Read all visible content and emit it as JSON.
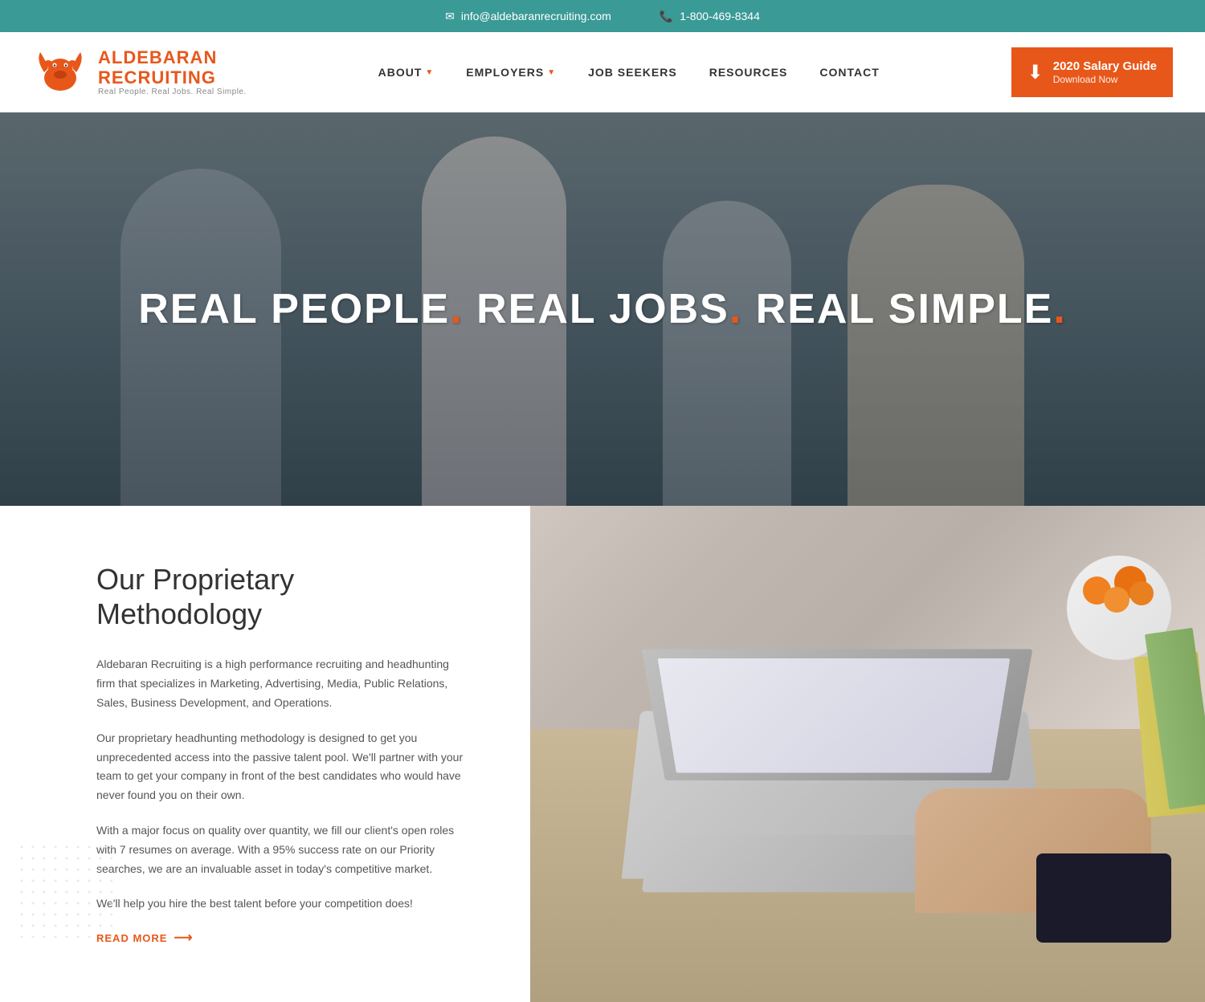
{
  "topbar": {
    "email": "info@aldebaranrecruiting.com",
    "phone": "1-800-469-8344"
  },
  "header": {
    "logo": {
      "name_line1": "ALDEBARAN",
      "name_line2": "RECRUITING",
      "tagline": "Real People. Real Jobs. Real Simple."
    },
    "nav": [
      {
        "label": "ABOUT",
        "has_dropdown": true
      },
      {
        "label": "EMPLOYERS",
        "has_dropdown": true
      },
      {
        "label": "JOB SEEKERS",
        "has_dropdown": false
      },
      {
        "label": "RESOURCES",
        "has_dropdown": false
      },
      {
        "label": "CONTACT",
        "has_dropdown": false
      }
    ],
    "cta": {
      "title": "2020 Salary Guide",
      "subtitle": "Download Now"
    }
  },
  "hero": {
    "title_part1": "REAL PEOPLE",
    "dot1": ".",
    "title_part2": " REAL JOBS",
    "dot2": ".",
    "title_part3": " REAL SIMPLE",
    "dot3": "."
  },
  "methodology": {
    "title": "Our Proprietary Methodology",
    "para1": "Aldebaran Recruiting is a high performance recruiting and headhunting firm that specializes in Marketing, Advertising, Media, Public Relations, Sales, Business Development, and Operations.",
    "para2": "Our proprietary headhunting methodology is designed to get you unprecedented access into the passive talent pool. We'll partner with your team to get your company in front of the best candidates who would have never found you on their own.",
    "para3": "With a major focus on quality over quantity, we fill our client's open roles with 7 resumes on average. With a 95% success rate on our Priority searches, we are an invaluable asset in today's competitive market.",
    "para4": "We'll help you hire the best talent before your competition does!",
    "read_more": "READ MORE"
  },
  "colors": {
    "teal": "#3a9a96",
    "orange": "#e8571a",
    "dark_text": "#333333",
    "mid_text": "#555555"
  }
}
